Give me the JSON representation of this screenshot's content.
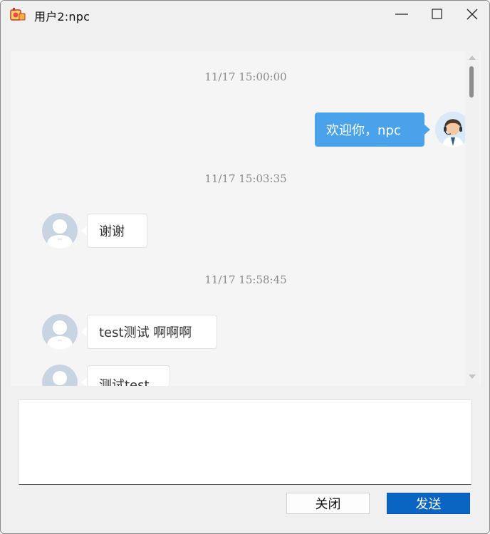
{
  "window": {
    "title": "用户2:npc"
  },
  "chat": {
    "messages": [
      {
        "time": "11/17 15:00:00",
        "side": "right",
        "text": "欢迎你，npc"
      },
      {
        "time": "11/17 15:03:35",
        "side": "left",
        "text": "谢谢"
      },
      {
        "time": "11/17 15:58:45",
        "side": "left",
        "text": "test测试 啊啊啊"
      },
      {
        "time": "",
        "side": "left",
        "text": "测试test"
      }
    ]
  },
  "actions": {
    "close_label": "关闭",
    "send_label": "发送"
  },
  "colors": {
    "accent": "#4aa3ea",
    "send_button": "#0a65c2"
  },
  "icons": {
    "app": "app-icon",
    "minimize": "minimize-icon",
    "maximize": "maximize-icon",
    "close": "close-icon",
    "self_avatar": "agent-avatar-icon",
    "peer_avatar": "user-avatar-icon"
  }
}
